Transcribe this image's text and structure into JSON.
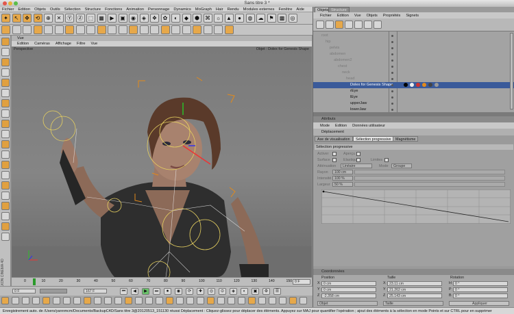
{
  "window_title": "Sans titre 3 *",
  "menu": [
    "Fichier",
    "Edition",
    "Objets",
    "Outils",
    "Sélection",
    "Structure",
    "Fonctions",
    "Animation",
    "Personnage",
    "Dynamics",
    "MoGraph",
    "Hair",
    "Rendu",
    "Modules externes",
    "Fenêtre",
    "Aide"
  ],
  "viewport": {
    "header": "Vue",
    "menu": [
      "Edition",
      "Caméras",
      "Affichage",
      "Filtre",
      "Vue"
    ],
    "label": "Perspective",
    "hud_label": "Objet : Dolex for Genesis Shape"
  },
  "timeline": {
    "ticks": [
      "0",
      "10",
      "20",
      "30",
      "40",
      "50",
      "60",
      "70",
      "80",
      "90",
      "100",
      "110",
      "120",
      "130",
      "140",
      "150"
    ],
    "current": "0 F",
    "start_field": "0 F",
    "end_field": "167 F",
    "zoom_field": "0 F"
  },
  "objects_panel": {
    "tabs": [
      "Objets",
      "Structure"
    ],
    "menu": [
      "Fichier",
      "Edition",
      "Vue",
      "Objets",
      "Propriétés",
      "Signets"
    ],
    "rows": [
      {
        "label": "root",
        "indent": 0
      },
      {
        "label": "hip",
        "indent": 1
      },
      {
        "label": "pelvis",
        "indent": 2
      },
      {
        "label": "abdomen",
        "indent": 2
      },
      {
        "label": "abdomen2",
        "indent": 3
      },
      {
        "label": "chest",
        "indent": 4
      },
      {
        "label": "neck",
        "indent": 5
      },
      {
        "label": "head",
        "indent": 6
      },
      {
        "label": "Dolex for Genesis Shape",
        "indent": 7,
        "selected": true
      },
      {
        "label": "rEye",
        "indent": 7
      },
      {
        "label": "lEye",
        "indent": 7
      },
      {
        "label": "upperJaw",
        "indent": 7
      },
      {
        "label": "lowerJaw",
        "indent": 7
      }
    ]
  },
  "attributes_panel": {
    "title": "Attributs",
    "menu": [
      "Mode",
      "Edition",
      "Données utilisateur"
    ],
    "object_title": "Déplacement",
    "tabs": [
      "Axe de visualisation",
      "Sélection progressive",
      "Magnétisme"
    ],
    "active_tab": "Sélection progressive",
    "section": "Sélection progressive",
    "options": {
      "actives": "Activer",
      "apercu": "Aperçu",
      "surface": "Surface",
      "elastique": "Elastique",
      "limites": "Limites",
      "attenuation_label": "Atténuation",
      "attenuation_value": "Linéaire",
      "mode_label": "Mode",
      "mode_value": "Groupe",
      "rayon_label": "Rayon",
      "rayon_value": "100 cm",
      "intensite_label": "Intensité",
      "intensite_value": "100 %",
      "largeur_label": "Largeur",
      "largeur_value": "50 %"
    }
  },
  "coords_panel": {
    "title": "Coordonnées",
    "headers": [
      "Position",
      "Taille",
      "Rotation"
    ],
    "position": [
      {
        "axis": "X",
        "value": "0 cm"
      },
      {
        "axis": "Y",
        "value": "0 cm"
      },
      {
        "axis": "Z",
        "value": "-2.358 cm"
      }
    ],
    "size": [
      {
        "axis": "X",
        "value": "23.11 cm"
      },
      {
        "axis": "Y",
        "value": "21.262 cm"
      },
      {
        "axis": "Z",
        "value": "25.143 cm"
      }
    ],
    "rotation": [
      {
        "axis": "H",
        "value": "0 °"
      },
      {
        "axis": "P",
        "value": "0 °"
      },
      {
        "axis": "B",
        "value": "0 °"
      }
    ],
    "mode_left": "Objet",
    "mode_mid": "Taille",
    "apply": "Appliquer"
  },
  "status": "Enregistrement auto. de /Users/yannmcm/Documents/BackupC4D/Sans titre 3@20120513_151130 réussi  Déplacement : Cliquez-glissez pour déplacer des éléments. Appuyez sur MAJ pour quantifier l'opération ; ajout des éléments à la sélection en mode Points et sur CTRL pour en supprimer",
  "side_label": "MAXON CINEMA 4D",
  "colors": {
    "accent": "#e38a1a",
    "selected_row": "#3a5a9a",
    "panel": "#9a9a9a"
  }
}
